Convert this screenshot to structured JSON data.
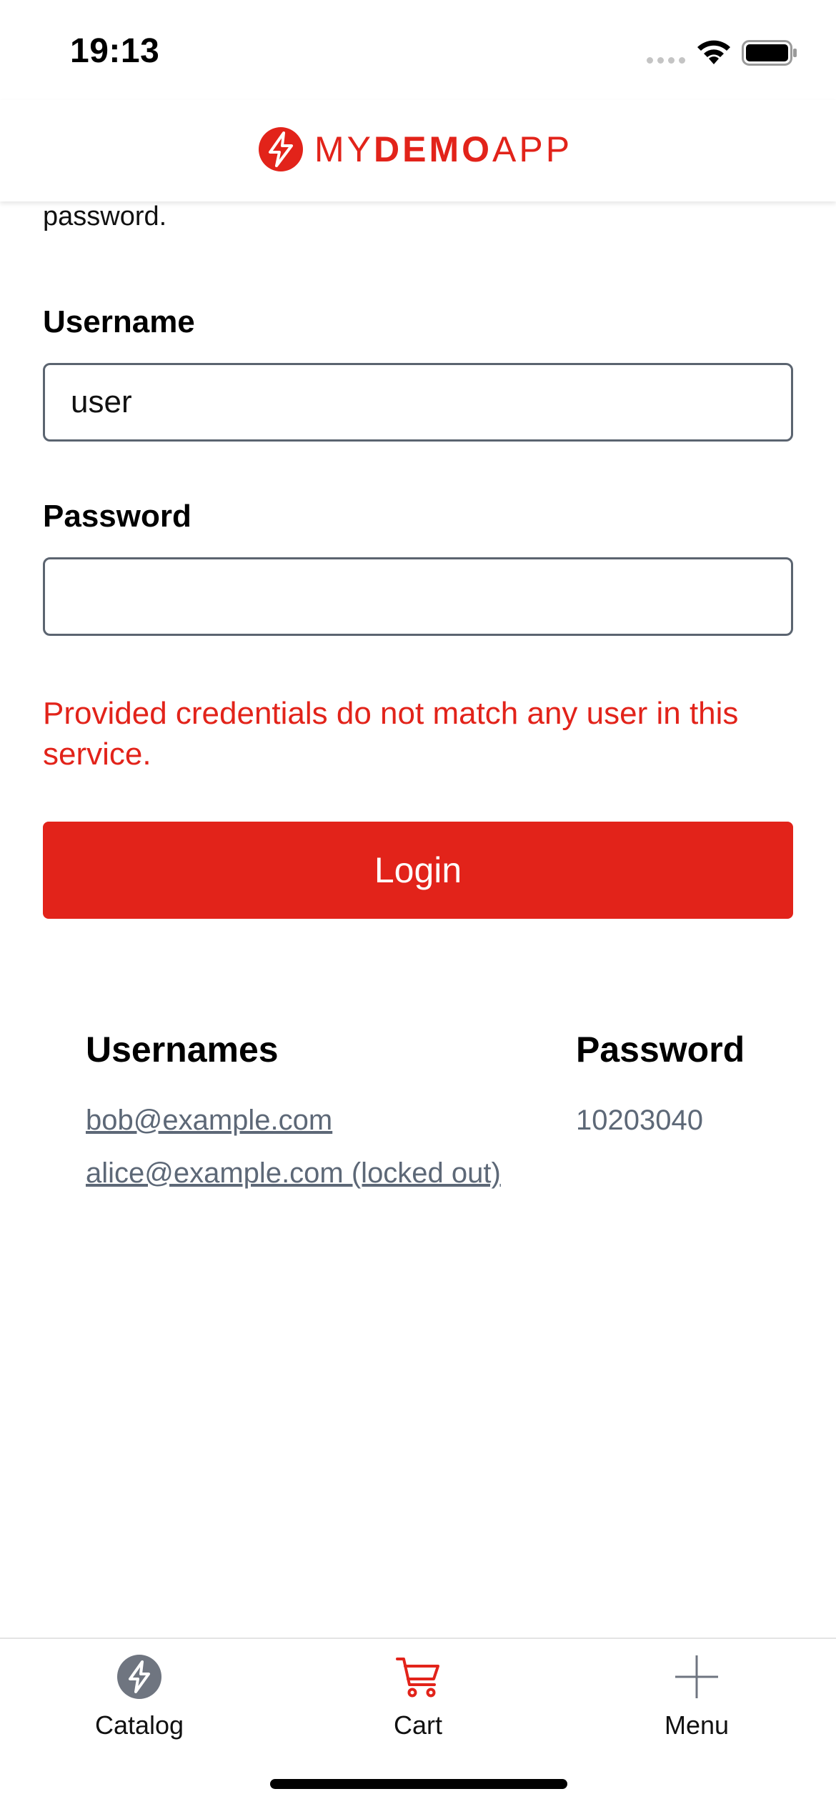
{
  "status_bar": {
    "time": "19:13"
  },
  "header": {
    "logo_text_my": "MY",
    "logo_text_demo": "DEMO",
    "logo_text_app": "APP",
    "logo_icon": "lightning-bolt-logo-icon"
  },
  "form": {
    "intro_text": "password.",
    "username_label": "Username",
    "username_value": "user",
    "password_label": "Password",
    "password_value": "",
    "error_message": "Provided credentials do not match any user in this service.",
    "login_label": "Login"
  },
  "credentials": {
    "usernames_heading": "Usernames",
    "password_heading": "Password",
    "usernames": [
      "bob@example.com",
      "alice@example.com (locked out)"
    ],
    "password": "10203040"
  },
  "tab_bar": {
    "items": [
      {
        "label": "Catalog",
        "icon": "catalog-icon",
        "active": false
      },
      {
        "label": "Cart",
        "icon": "cart-icon",
        "active": true
      },
      {
        "label": "Menu",
        "icon": "plus-menu-icon",
        "active": false
      }
    ]
  },
  "colors": {
    "brand_red": "#e2231a",
    "link_gray": "#5d6877",
    "input_border": "#5b6470"
  }
}
